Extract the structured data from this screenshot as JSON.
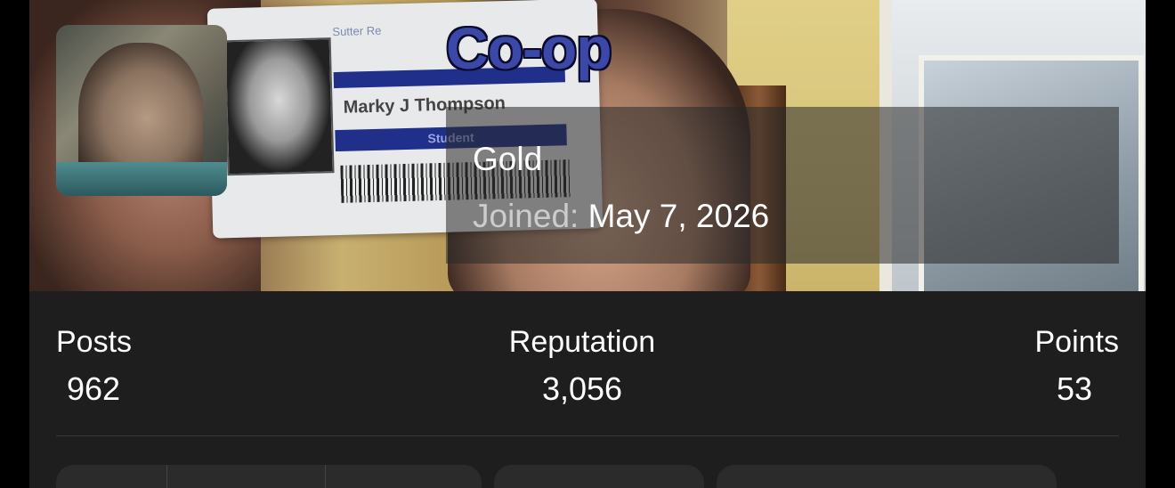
{
  "profile": {
    "username": "Co-op",
    "rank": "Gold",
    "joined_label": "Joined:",
    "joined_date": "May 7, 2026"
  },
  "stats": [
    {
      "label": "Posts",
      "value": "962"
    },
    {
      "label": "Reputation",
      "value": "3,056"
    },
    {
      "label": "Points",
      "value": "53"
    }
  ],
  "cover": {
    "id_card_name": "Marky J Thompson",
    "id_card_role": "Student",
    "id_card_header": "Sutter Re"
  },
  "colors": {
    "username": "#3c48a8",
    "card_bg": "#1e1e1e",
    "page_bg": "#000000"
  }
}
